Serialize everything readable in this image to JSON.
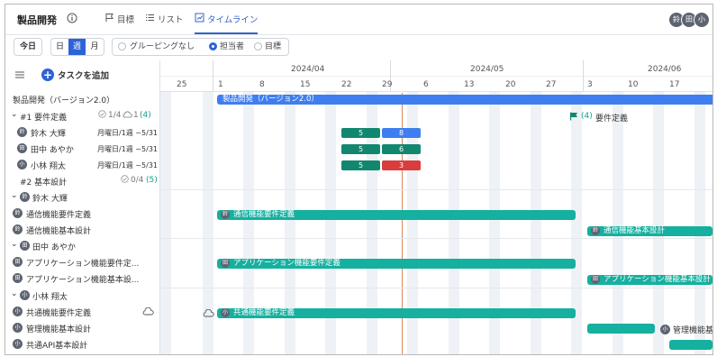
{
  "header": {
    "title": "製品開発",
    "tabs": [
      {
        "label": "目標",
        "icon": "flag-icon"
      },
      {
        "label": "リスト",
        "icon": "list-icon"
      },
      {
        "label": "タイムライン",
        "icon": "timeline-icon",
        "active": true
      }
    ],
    "avatars": [
      "鈴",
      "田",
      "小"
    ]
  },
  "toolbar": {
    "today": "今日",
    "scale": [
      "日",
      "週",
      "月"
    ],
    "scale_selected": "週",
    "grouping": [
      "グルーピングなし",
      "担当者",
      "目標"
    ],
    "grouping_selected": "担当者"
  },
  "left_panel": {
    "add_task": "タスクを追加",
    "project": "製品開発（バージョン2.0）",
    "goal1": {
      "label": "#1 要件定義",
      "stat1": "1/4",
      "stat2": "1",
      "stat3": "(4)"
    },
    "goal1_rows": [
      {
        "avatar": "鈴",
        "name": "鈴木 大輝",
        "due": "月曜日/1週 ~5/31"
      },
      {
        "avatar": "田",
        "name": "田中 あやか",
        "due": "月曜日/1週 ~5/31"
      },
      {
        "avatar": "小",
        "name": "小林 翔太",
        "due": "月曜日/1週 ~5/31"
      }
    ],
    "goal2": {
      "label": "#2 基本設計",
      "stat1": "0/4",
      "stat2": "(5)"
    },
    "groups": [
      {
        "avatar": "鈴",
        "name": "鈴木 大輝",
        "tasks": [
          "通信機能要件定義",
          "通信機能基本設計"
        ]
      },
      {
        "avatar": "田",
        "name": "田中 あやか",
        "tasks": [
          "アプリケーション機能要件定...",
          "アプリケーション機能基本設..."
        ]
      },
      {
        "avatar": "小",
        "name": "小林 翔太",
        "tasks": [
          "共通機能要件定義",
          "管理機能基本設計",
          "共通API基本設計"
        ]
      }
    ]
  },
  "timeline": {
    "months": [
      "2024/04",
      "2024/05",
      "2024/06"
    ],
    "days": [
      "25",
      "1",
      "8",
      "15",
      "22",
      "29",
      "6",
      "13",
      "20",
      "27",
      "3",
      "10",
      "17"
    ],
    "milestone": {
      "label": "要件定義",
      "count": "(4)"
    },
    "project_bar": "製品開発（バージョン2.0）",
    "counts": [
      {
        "a": "5",
        "b": "8",
        "b_color": "#3f7ef0"
      },
      {
        "a": "5",
        "b": "6",
        "b_color": "#12876f"
      },
      {
        "a": "5",
        "b": "3",
        "b_color": "#d93d3d"
      }
    ],
    "bars": [
      {
        "label": "通信機能要件定義",
        "avatar": "鈴"
      },
      {
        "label": "通信機能基本設計",
        "avatar": "鈴"
      },
      {
        "label": "アプリケーション機能要件定義",
        "avatar": "田"
      },
      {
        "label": "アプリケーション機能基本設計",
        "avatar": "田"
      },
      {
        "label": "共通機能要件定義",
        "avatar": "小"
      },
      {
        "label": "管理機能基本",
        "avatar": "小"
      }
    ]
  },
  "colors": {
    "accent": "#3564c9",
    "teal": "#15b09f",
    "green": "#12876f",
    "blue": "#3f7ef0",
    "red": "#d93d3d",
    "today": "#d9865a"
  }
}
